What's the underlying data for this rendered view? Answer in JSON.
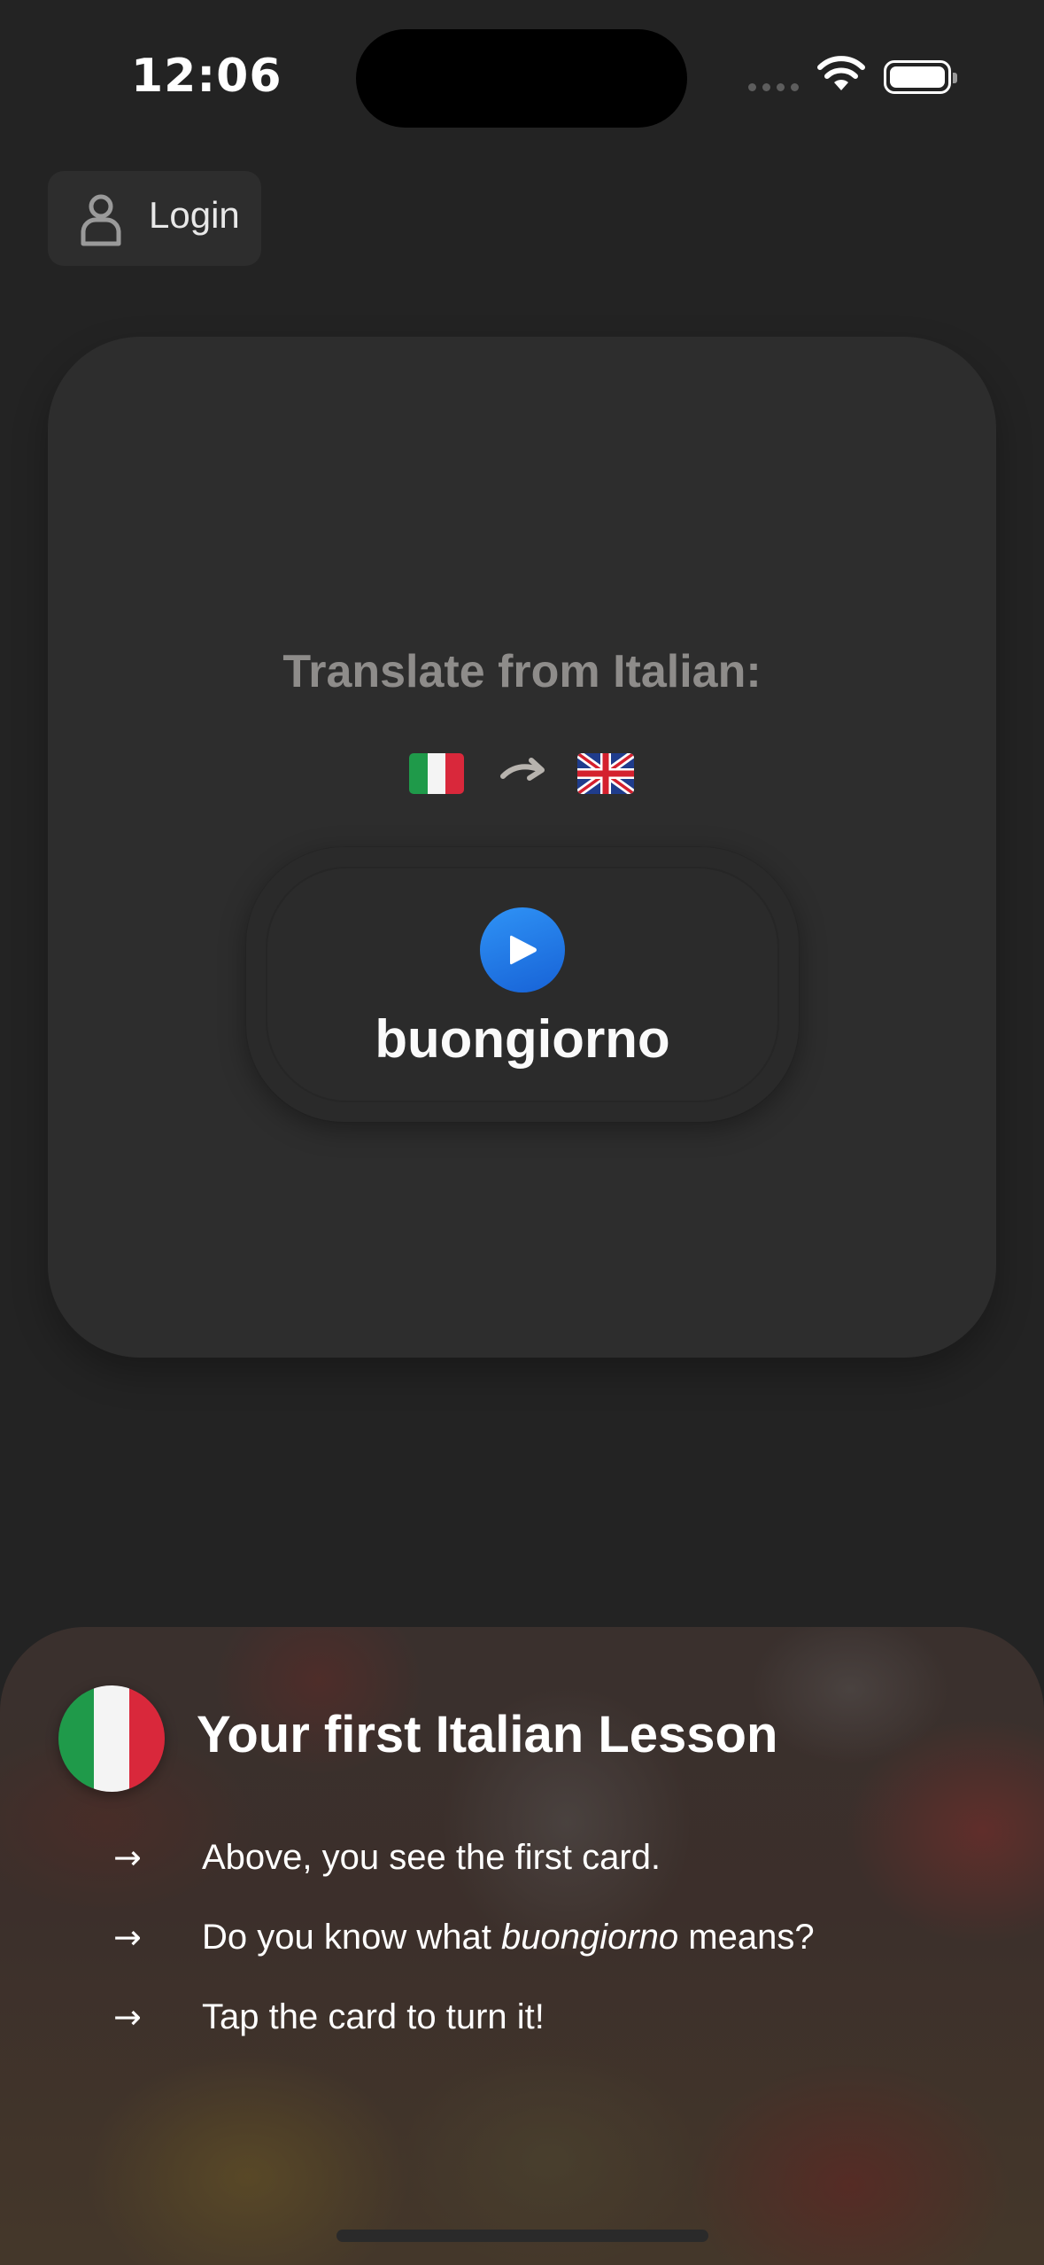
{
  "status_bar": {
    "time": "12:06"
  },
  "header": {
    "login_label": "Login",
    "login_icon": "user-icon"
  },
  "card": {
    "prompt": "Translate from Italian:",
    "source_flag": "italy-flag-icon",
    "direction_icon": "curved-arrow-icon",
    "target_flag": "uk-flag-icon",
    "word": "buongiorno",
    "play_icon": "play-icon",
    "accent_color": "#1e7cf0"
  },
  "lesson": {
    "badge_icon": "italy-flag-icon",
    "title": "Your first Italian Lesson",
    "bullets": [
      {
        "arrow": "→",
        "text": "Above, you see the first card."
      },
      {
        "arrow": "→",
        "prefix": "Do you know what ",
        "emphasis": "buongiorno",
        "suffix": " means?"
      },
      {
        "arrow": "→",
        "text": "Tap the card to turn it!"
      }
    ]
  },
  "colors": {
    "background": "#232323",
    "card": "#2d2d2d",
    "italy_green": "#1f9a4a",
    "italy_white": "#f4f4f4",
    "italy_red": "#d9283b"
  }
}
